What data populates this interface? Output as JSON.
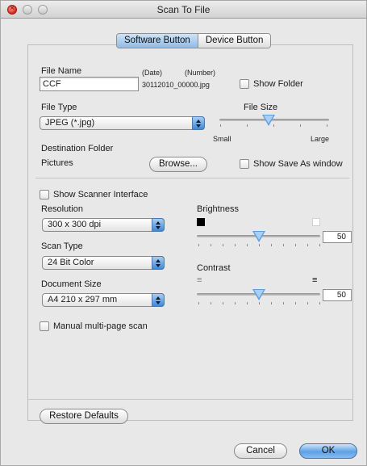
{
  "window": {
    "title": "Scan To File"
  },
  "tabs": [
    {
      "label": "Software Button",
      "active": true
    },
    {
      "label": "Device Button",
      "active": false
    }
  ],
  "file_name": {
    "label": "File Name",
    "value": "CCF"
  },
  "name_hints": {
    "date_label": "(Date)",
    "number_label": "(Number)",
    "example": "30112010_00000.jpg"
  },
  "show_folder": {
    "label": "Show Folder",
    "checked": false
  },
  "file_type": {
    "label": "File Type",
    "selected": "JPEG (*.jpg)"
  },
  "file_size": {
    "label": "File Size",
    "min_label": "Small",
    "max_label": "Large",
    "level": 0.5
  },
  "destination": {
    "label": "Destination Folder",
    "value": "Pictures",
    "browse_label": "Browse..."
  },
  "show_save_as": {
    "label": "Show Save As window",
    "checked": false
  },
  "show_scanner_interface": {
    "label": "Show Scanner Interface",
    "checked": false
  },
  "resolution": {
    "label": "Resolution",
    "selected": "300 x 300 dpi"
  },
  "scan_type": {
    "label": "Scan Type",
    "selected": "24 Bit Color"
  },
  "document_size": {
    "label": "Document Size",
    "selected": "A4  210 x 297 mm"
  },
  "manual_multipage": {
    "label": "Manual multi-page scan",
    "checked": false
  },
  "brightness": {
    "label": "Brightness",
    "value": "50"
  },
  "contrast": {
    "label": "Contrast",
    "value": "50"
  },
  "buttons": {
    "restore_defaults": "Restore Defaults",
    "cancel": "Cancel",
    "ok": "OK"
  },
  "colors": {
    "accent": "#5e9ede",
    "ok_button": "#5ea1e6",
    "close_button": "#d3261b"
  }
}
